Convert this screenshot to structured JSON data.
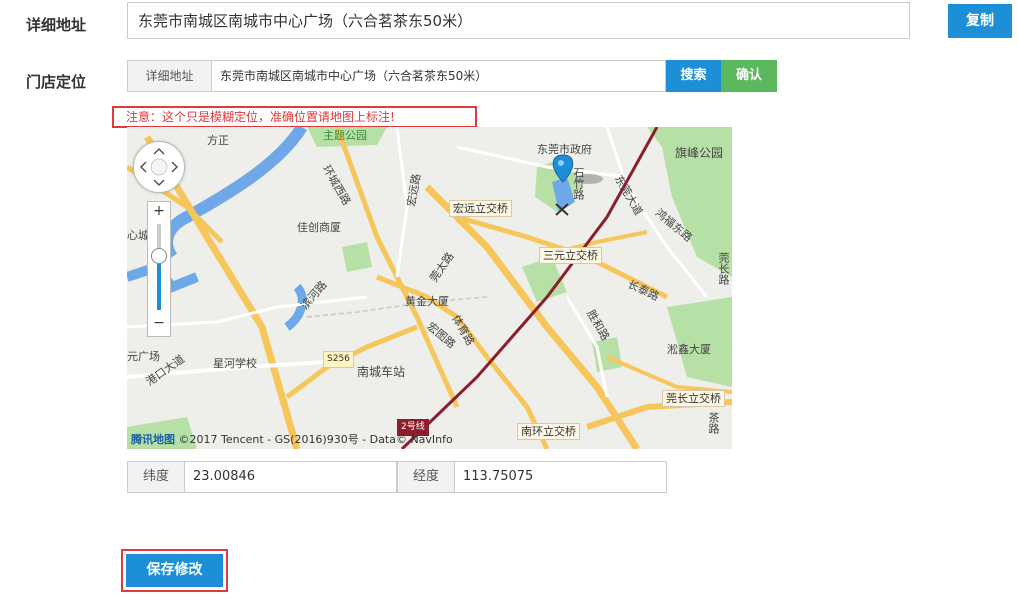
{
  "form": {
    "address_label": "详细地址",
    "address_value": "东莞市南城区南城市中心广场（六合茗茶东50米）",
    "copy_label": "复制",
    "location_label": "门店定位",
    "location_addon": "详细地址",
    "location_value": "东莞市南城区南城市中心广场（六合茗茶东50米）",
    "search_label": "搜索",
    "confirm_label": "确认",
    "notice": "注意：这个只是模糊定位，准确位置请地图上标注!",
    "lat_label": "纬度",
    "lat_value": "23.00846",
    "lng_label": "经度",
    "lng_value": "113.75075",
    "save_label": "保存修改"
  },
  "map": {
    "labels": [
      "主题公园",
      "东莞市政府",
      "旗峰公园",
      "佳创商厦",
      "黄金大厦",
      "南城车站",
      "淞鑫大厦",
      "石竹路",
      "鸿福东路",
      "环城西路",
      "莞太路",
      "宏图路",
      "东莞大道",
      "长泰路",
      "胜和路",
      "莞长路",
      "星河学校",
      "港口大道",
      "心城",
      "方正",
      "元广场",
      "宏远路",
      "滨河路",
      "体育路",
      "茶路"
    ],
    "tags": [
      "宏远立交桥",
      "三元立交桥",
      "莞长立交桥",
      "南环立交桥",
      "S256",
      "2号线"
    ],
    "zoom_in": "+",
    "zoom_out": "−",
    "footer_logo": "腾讯地图",
    "footer_text": "©2017 Tencent - GS(2016)930号 - Data© NavInfo"
  },
  "colors": {
    "primary": "#1c8fd6",
    "success": "#5cb85c",
    "danger": "#e0393e",
    "water": "#6ea8e8",
    "park": "#b7e0a6",
    "road_main": "#f7c65a"
  }
}
